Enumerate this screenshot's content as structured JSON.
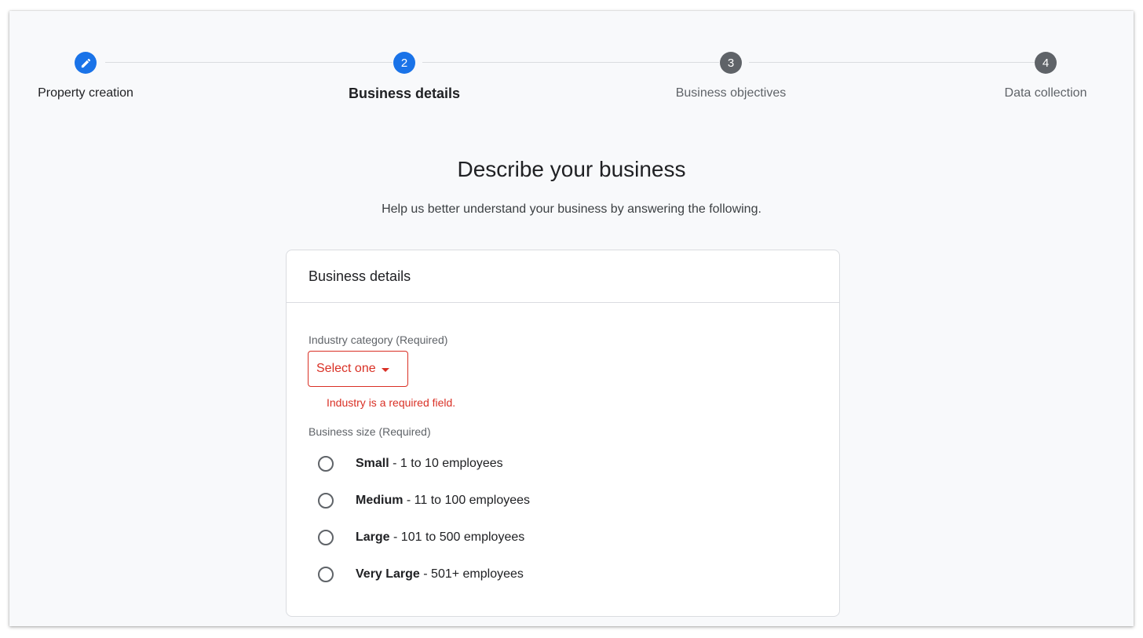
{
  "stepper": {
    "steps": [
      {
        "number": "",
        "label": "Property creation",
        "state": "completed",
        "icon": "pencil-icon"
      },
      {
        "number": "2",
        "label": "Business details",
        "state": "current"
      },
      {
        "number": "3",
        "label": "Business objectives",
        "state": "upcoming"
      },
      {
        "number": "4",
        "label": "Data collection",
        "state": "upcoming"
      }
    ]
  },
  "page": {
    "title": "Describe your business",
    "subtitle": "Help us better understand your business by answering the following."
  },
  "card": {
    "title": "Business details",
    "industry": {
      "label": "Industry category (Required)",
      "value": "Select one",
      "error": "Industry is a required field."
    },
    "size": {
      "label": "Business size (Required)",
      "options": [
        {
          "name": "Small",
          "detail": " - 1 to 10 employees"
        },
        {
          "name": "Medium",
          "detail": " - 11 to 100 employees"
        },
        {
          "name": "Large",
          "detail": " - 101 to 500 employees"
        },
        {
          "name": "Very Large",
          "detail": " - 501+ employees"
        }
      ]
    }
  },
  "colors": {
    "accent": "#1a73e8",
    "error": "#d93025",
    "inactive_step": "#5f6368"
  }
}
